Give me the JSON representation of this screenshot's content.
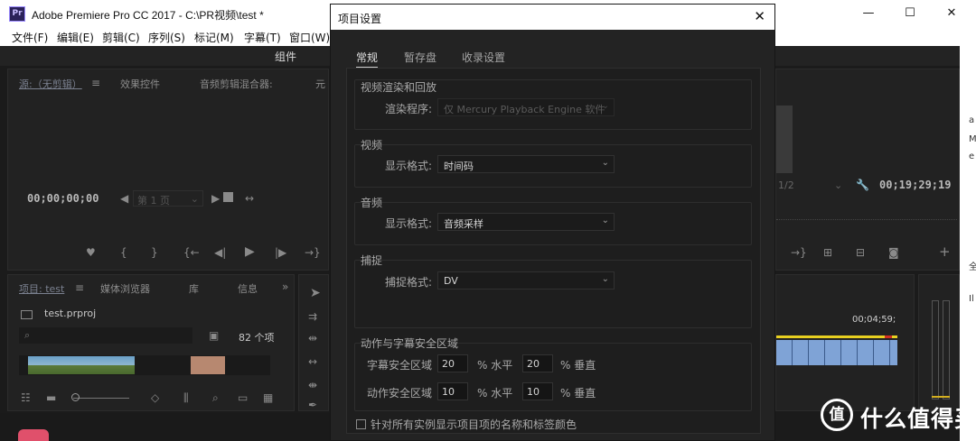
{
  "window": {
    "logo_text": "Pr",
    "title": "Adobe Premiere Pro CC 2017 - C:\\PR视频\\test *",
    "minimize": "—",
    "maximize": "☐",
    "close": "✕"
  },
  "menu": [
    "文件(F)",
    "编辑(E)",
    "剪辑(C)",
    "序列(S)",
    "标记(M)",
    "字幕(T)",
    "窗口(W)"
  ],
  "workspace": {
    "label": "组件"
  },
  "source_panel": {
    "tabs": [
      "源:（无剪辑）",
      "效果控件",
      "音频剪辑混合器:",
      "元"
    ],
    "timecode_left": "00;00;00;00",
    "page_select": "第 1 页"
  },
  "program_panel": {
    "resolution": "1/2",
    "timecode_right": "00;19;29;19"
  },
  "project_panel": {
    "tabs": [
      "项目: test",
      "媒体浏览器",
      "库",
      "信息"
    ],
    "file_name": "test.prproj",
    "item_count": "82 个项"
  },
  "timeline": {
    "timecode": "00;04;59;"
  },
  "dialog": {
    "title": "项目设置",
    "close": "✕",
    "tabs": [
      "常规",
      "暂存盘",
      "收录设置"
    ],
    "video_render": {
      "title": "视频渲染和回放",
      "renderer_label": "渲染程序:",
      "renderer_value": "仅 Mercury Playback Engine 软件"
    },
    "video": {
      "title": "视频",
      "display_label": "显示格式:",
      "display_value": "时间码"
    },
    "audio": {
      "title": "音频",
      "display_label": "显示格式:",
      "display_value": "音频采样"
    },
    "capture": {
      "title": "捕捉",
      "format_label": "捕捉格式:",
      "format_value": "DV"
    },
    "safe_zones": {
      "title": "动作与字幕安全区域",
      "title_safe_label": "字幕安全区域",
      "title_safe_h": "20",
      "title_safe_v": "20",
      "action_safe_label": "动作安全区域",
      "action_safe_h": "10",
      "action_safe_v": "10",
      "unit_h": "% 水平",
      "unit_v": "% 垂直"
    },
    "checkbox_label": "针对所有实例显示项目项的名称和标签颜色"
  },
  "watermark": {
    "logo": "值",
    "text": "什么值得买"
  },
  "right_strip_chars": [
    "a",
    "M",
    "e",
    "全",
    "Il"
  ]
}
